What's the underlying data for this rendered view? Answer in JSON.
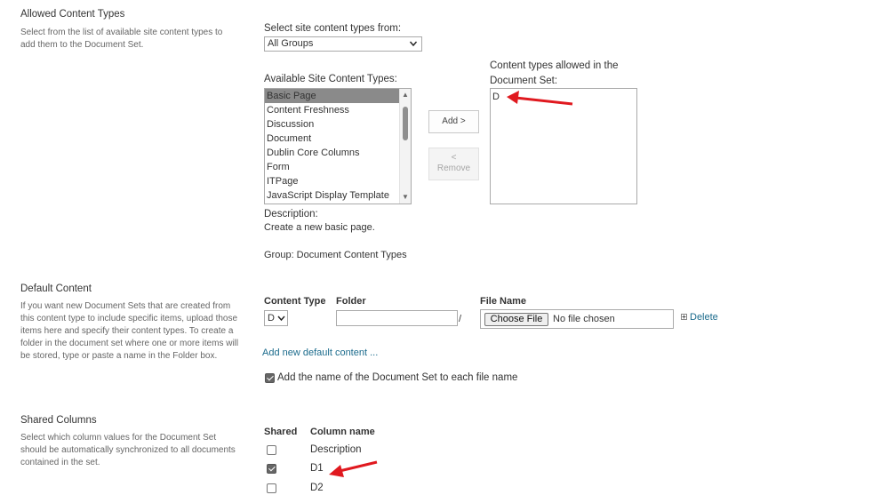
{
  "allowed_content_types": {
    "title": "Allowed Content Types",
    "description": "Select from the list of available site content types to add them to the Document Set.",
    "select_from_label": "Select site content types from:",
    "select_from_value": "All Groups",
    "available_label": "Available Site Content Types:",
    "available_items": [
      "Basic Page",
      "Content Freshness",
      "Discussion",
      "Document",
      "Dublin Core Columns",
      "Form",
      "ITPage",
      "JavaScript Display Template"
    ],
    "selected_index": 0,
    "add_button": "Add >",
    "remove_button_arrow": "<",
    "remove_button_label": "Remove",
    "allowed_label": "Content types allowed in the Document Set:",
    "allowed_items": [
      "D"
    ],
    "description_label": "Description:",
    "description_value": "Create a new basic page.",
    "group_text": "Group: Document Content Types"
  },
  "default_content": {
    "title": "Default Content",
    "description": "If you want new Document Sets that are created from this content type to include specific items, upload those items here and specify their content types. To create a folder in the document set where one or more items will be stored, type or paste a name in the Folder box.",
    "col_content_type": "Content Type",
    "col_folder": "Folder",
    "col_file_name": "File Name",
    "content_type_value": "D",
    "folder_value": "",
    "folder_separator": "/",
    "choose_file_button": "Choose File",
    "no_file_text": "No file chosen",
    "delete_link": "Delete",
    "add_new_link": "Add new default content ...",
    "add_name_checkbox_label": "Add the name of the Document Set to each file name",
    "add_name_checked": true
  },
  "shared_columns": {
    "title": "Shared Columns",
    "description": "Select which column values for the Document Set should be automatically synchronized to all documents contained in the set.",
    "col_shared": "Shared",
    "col_column_name": "Column name",
    "rows": [
      {
        "name": "Description",
        "checked": false
      },
      {
        "name": "D1",
        "checked": true
      },
      {
        "name": "D2",
        "checked": false
      }
    ]
  },
  "colors": {
    "annotation_arrow": "#e0191f",
    "link": "#1b6b8c",
    "selected_item_bg": "#8a8a8a"
  }
}
